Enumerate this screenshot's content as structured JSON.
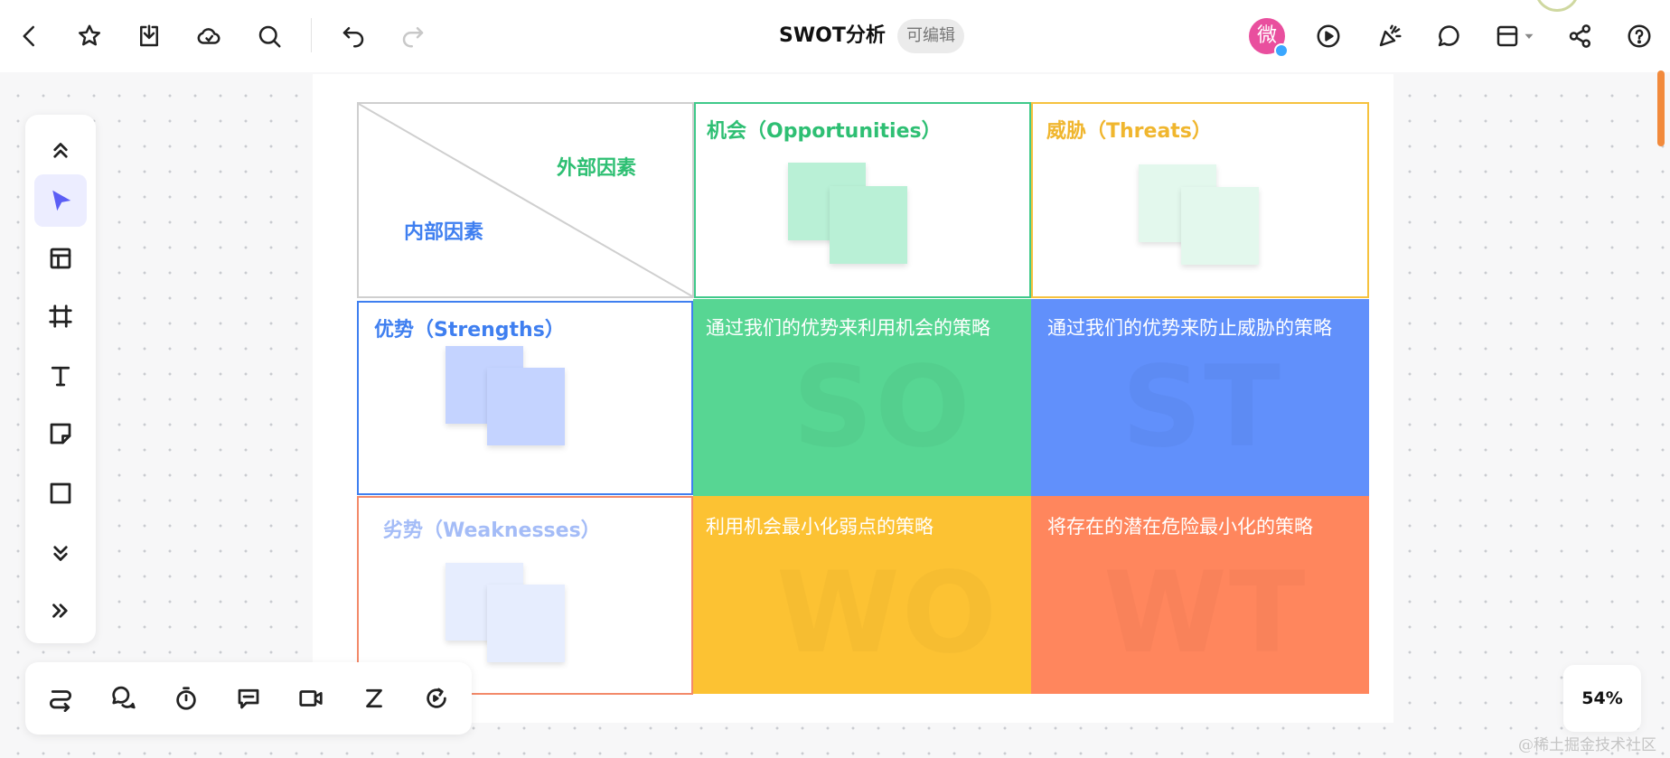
{
  "document": {
    "title": "SWOT分析",
    "badge": "可编辑",
    "avatar_char": "微",
    "zoom_level": "54%"
  },
  "icons": {
    "top_left": [
      "back-icon",
      "star-icon",
      "download-icon",
      "cloud-icon",
      "search-icon",
      "undo-icon",
      "redo-icon"
    ],
    "top_right": [
      "play-icon",
      "celebrate-icon",
      "comment-icon",
      "layout-icon",
      "share-icon",
      "help-icon"
    ],
    "left_tools": [
      "collapse-up-icon",
      "pointer-icon",
      "table-icon",
      "frame-icon",
      "text-icon",
      "sticky-note-icon",
      "rectangle-icon",
      "more-down-icon",
      "expand-right-icon"
    ],
    "bottom_tools": [
      "flow-icon",
      "chat-icon",
      "timer-icon",
      "message-icon",
      "video-icon",
      "z-icon",
      "sync-icon"
    ]
  },
  "swot": {
    "external_factors": "外部因素",
    "internal_factors": "内部因素",
    "opportunities": "机会（Opportunities）",
    "threats": "威胁（Threats）",
    "strengths": "优势（Strengths）",
    "weaknesses": "劣势（Weaknesses）",
    "so_strategy": "通过我们的优势来利用机会的策略",
    "st_strategy": "通过我们的优势来防止威胁的策略",
    "wo_strategy": "利用机会最小化弱点的策略",
    "wt_strategy": "将存在的潜在危险最小化的策略",
    "so_watermark": "SO",
    "st_watermark": "ST",
    "wo_watermark": "WO",
    "wt_watermark": "WT"
  },
  "colors": {
    "opportunities": "#3fc98a",
    "threats": "#f6c23e",
    "strengths": "#3f7ff0",
    "weaknesses": "#f38a6a",
    "so_fill": "#57d693",
    "st_fill": "#6190fb",
    "wo_fill": "#fcc233",
    "wt_fill": "#ff865d",
    "accent": "#5b5ef5"
  },
  "watermark": "@稀土掘金技术社区"
}
